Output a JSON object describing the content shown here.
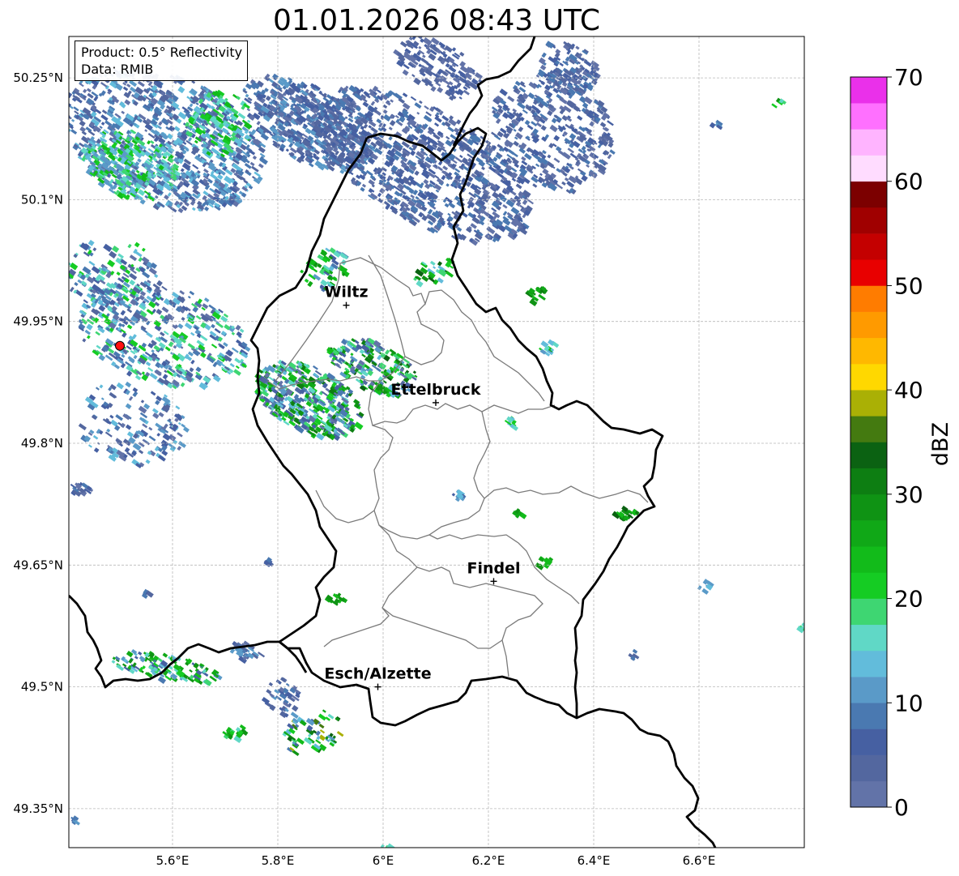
{
  "title": "01.01.2026 08:43 UTC",
  "info": {
    "product": "Product: 0.5° Reflectivity",
    "data": "Data: RMIB"
  },
  "map": {
    "lon_range": [
      5.4,
      6.8
    ],
    "lat_range": [
      49.3,
      50.3
    ],
    "lon_ticks": [
      "5.6°E",
      "5.8°E",
      "6°E",
      "6.2°E",
      "6.4°E",
      "6.6°E"
    ],
    "lat_ticks": [
      "50.25°N",
      "50.1°N",
      "49.95°N",
      "49.8°N",
      "49.65°N",
      "49.5°N",
      "49.35°N"
    ],
    "gridlines": true,
    "cities": [
      {
        "name": "Wiltz",
        "lon": 5.93,
        "lat": 49.97
      },
      {
        "name": "Ettelbruck",
        "lon": 6.1,
        "lat": 49.85
      },
      {
        "name": "Findel",
        "lon": 6.21,
        "lat": 49.63
      },
      {
        "name": "Esch/Alzette",
        "lon": 5.99,
        "lat": 49.5
      }
    ],
    "radar_site": {
      "lon": 5.5,
      "lat": 49.92,
      "color": "#ff1010"
    }
  },
  "colorbar": {
    "label": "dBZ",
    "min": 0,
    "max": 70,
    "tick_labels": [
      "0",
      "10",
      "20",
      "30",
      "40",
      "50",
      "60",
      "70"
    ],
    "colors": [
      "#6273a8",
      "#53679f",
      "#4660a2",
      "#4a79b1",
      "#5a9ac8",
      "#62bcdb",
      "#60d8c6",
      "#3ed672",
      "#15cc23",
      "#12bb1a",
      "#10a817",
      "#0f9314",
      "#0d7e12",
      "#0b6212",
      "#447a10",
      "#aab005",
      "#ffd800",
      "#ffb800",
      "#ff9a00",
      "#ff7c00",
      "#e80000",
      "#c40000",
      "#a00000",
      "#7c0000",
      "#ffdcff",
      "#ffb4ff",
      "#ff70ff",
      "#ea30ea"
    ]
  }
}
